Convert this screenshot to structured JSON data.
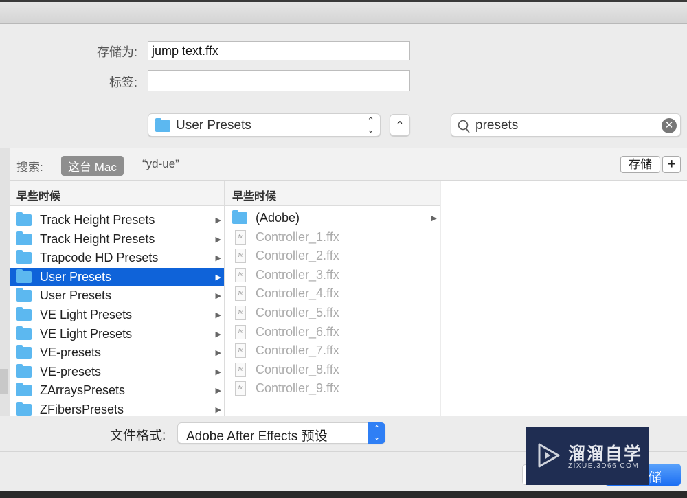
{
  "form": {
    "save_as_label": "存储为:",
    "save_as_value": "jump text.ffx",
    "tags_label": "标签:",
    "tags_value": ""
  },
  "toolbar": {
    "location": "User Presets",
    "search_value": "presets"
  },
  "search_scope": {
    "label": "搜索:",
    "this_mac": "这台 Mac",
    "folder": "“yd-ue”",
    "save_button": "存储",
    "add_button": "+"
  },
  "columns": [
    {
      "header": "早些时候",
      "selected": "User Presets",
      "items": [
        "Track Height Presets",
        "Track Height Presets",
        "Trapcode HD Presets",
        "User Presets",
        "User Presets",
        "VE Light Presets",
        "VE Light Presets",
        "VE-presets",
        "VE-presets",
        "ZArraysPresets",
        "ZFibersPresets"
      ]
    },
    {
      "header": "早些时候",
      "items": [
        "(Adobe)",
        "Controller_1.ffx",
        "Controller_2.ffx",
        "Controller_3.ffx",
        "Controller_4.ffx",
        "Controller_5.ffx",
        "Controller_6.ffx",
        "Controller_7.ffx",
        "Controller_8.ffx",
        "Controller_9.ffx"
      ]
    }
  ],
  "format": {
    "label": "文件格式:",
    "value": "Adobe After Effects 预设"
  },
  "buttons": {
    "save_partial": "储"
  },
  "watermark": {
    "title": "溜溜自学",
    "url": "ZIXUE.3D66.COM"
  },
  "colors": {
    "selection": "#0f63d9",
    "folder": "#5cb8f0",
    "watermark_bg": "#1f2d52"
  }
}
